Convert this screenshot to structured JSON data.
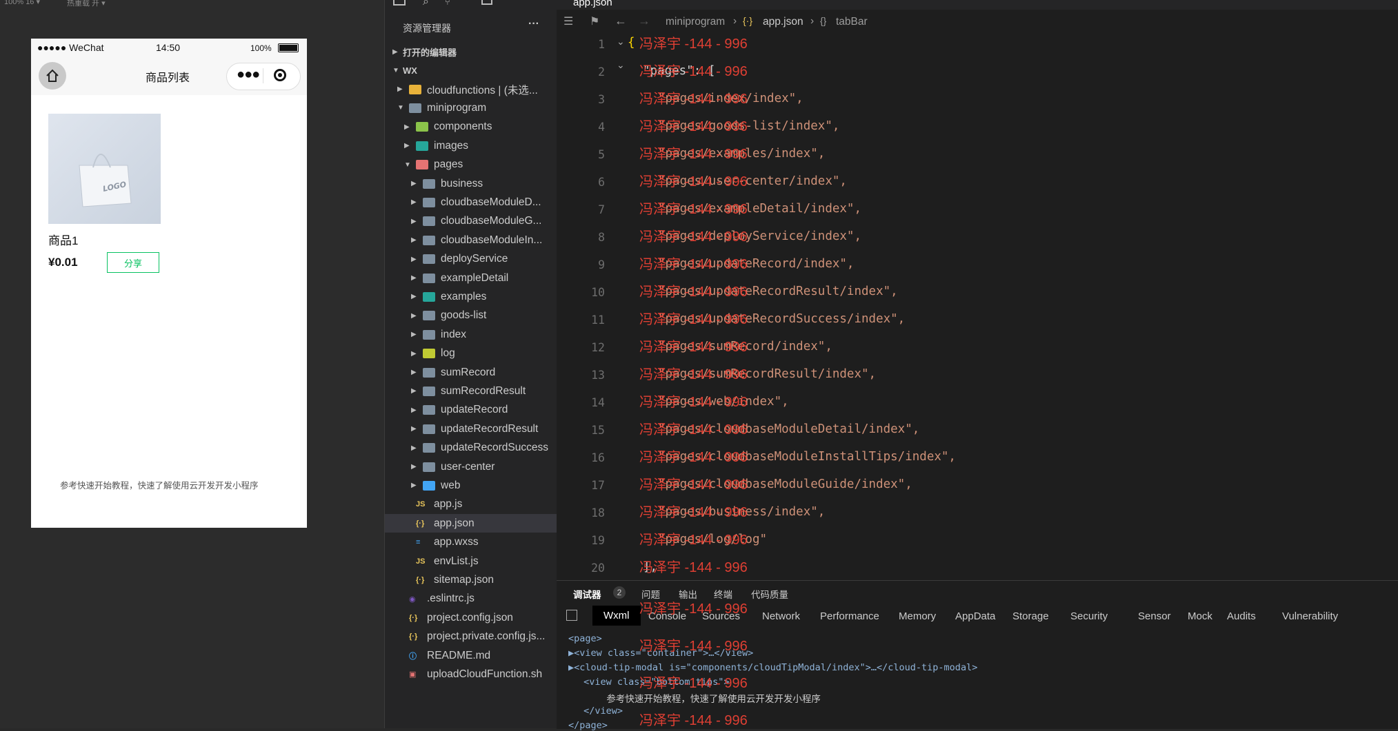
{
  "simulator": {
    "topbar_left": "100% 16 ▾",
    "topbar_mid": "热重载 开 ▾",
    "status": {
      "carrier": "●●●●● WeChat",
      "time": "14:50",
      "battery": "100%"
    },
    "nav_title": "商品列表",
    "product": {
      "name": "商品1",
      "price": "¥0.01",
      "share_label": "分享",
      "image_logo": "LOGO"
    },
    "bottom_tip": "参考快速开始教程，快速了解使用云开发开发小程序"
  },
  "explorer": {
    "title": "资源管理器",
    "more": "···",
    "section_open": "打开的编辑器",
    "section_root": "WX",
    "items": [
      {
        "label": "cloudfunctions | (未选...",
        "depth": 1,
        "chev": "▶",
        "icon": "folder-cloud"
      },
      {
        "label": "miniprogram",
        "depth": 1,
        "chev": "▼",
        "icon": "folder-open"
      },
      {
        "label": "components",
        "depth": 2,
        "chev": "▶",
        "icon": "folder-components"
      },
      {
        "label": "images",
        "depth": 2,
        "chev": "▶",
        "icon": "folder-images"
      },
      {
        "label": "pages",
        "depth": 2,
        "chev": "▼",
        "icon": "folder-pages"
      },
      {
        "label": "business",
        "depth": 3,
        "chev": "▶",
        "icon": "folder"
      },
      {
        "label": "cloudbaseModuleD...",
        "depth": 3,
        "chev": "▶",
        "icon": "folder"
      },
      {
        "label": "cloudbaseModuleG...",
        "depth": 3,
        "chev": "▶",
        "icon": "folder"
      },
      {
        "label": "cloudbaseModuleIn...",
        "depth": 3,
        "chev": "▶",
        "icon": "folder"
      },
      {
        "label": "deployService",
        "depth": 3,
        "chev": "▶",
        "icon": "folder"
      },
      {
        "label": "exampleDetail",
        "depth": 3,
        "chev": "▶",
        "icon": "folder"
      },
      {
        "label": "examples",
        "depth": 3,
        "chev": "▶",
        "icon": "folder-examples"
      },
      {
        "label": "goods-list",
        "depth": 3,
        "chev": "▶",
        "icon": "folder"
      },
      {
        "label": "index",
        "depth": 3,
        "chev": "▶",
        "icon": "folder"
      },
      {
        "label": "log",
        "depth": 3,
        "chev": "▶",
        "icon": "folder-log"
      },
      {
        "label": "sumRecord",
        "depth": 3,
        "chev": "▶",
        "icon": "folder"
      },
      {
        "label": "sumRecordResult",
        "depth": 3,
        "chev": "▶",
        "icon": "folder"
      },
      {
        "label": "updateRecord",
        "depth": 3,
        "chev": "▶",
        "icon": "folder"
      },
      {
        "label": "updateRecordResult",
        "depth": 3,
        "chev": "▶",
        "icon": "folder"
      },
      {
        "label": "updateRecordSuccess",
        "depth": 3,
        "chev": "▶",
        "icon": "folder"
      },
      {
        "label": "user-center",
        "depth": 3,
        "chev": "▶",
        "icon": "folder"
      },
      {
        "label": "web",
        "depth": 3,
        "chev": "▶",
        "icon": "folder-web"
      },
      {
        "label": "app.js",
        "depth": 2,
        "chev": "",
        "icon": "js"
      },
      {
        "label": "app.json",
        "depth": 2,
        "chev": "",
        "icon": "json",
        "selected": true
      },
      {
        "label": "app.wxss",
        "depth": 2,
        "chev": "",
        "icon": "css"
      },
      {
        "label": "envList.js",
        "depth": 2,
        "chev": "",
        "icon": "js"
      },
      {
        "label": "sitemap.json",
        "depth": 2,
        "chev": "",
        "icon": "json"
      },
      {
        "label": ".eslintrc.js",
        "depth": 1,
        "chev": "",
        "icon": "eslint"
      },
      {
        "label": "project.config.json",
        "depth": 1,
        "chev": "",
        "icon": "json"
      },
      {
        "label": "project.private.config.js...",
        "depth": 1,
        "chev": "",
        "icon": "json"
      },
      {
        "label": "README.md",
        "depth": 1,
        "chev": "",
        "icon": "info"
      },
      {
        "label": "uploadCloudFunction.sh",
        "depth": 1,
        "chev": "",
        "icon": "shell"
      }
    ]
  },
  "editor": {
    "tab": "app.json",
    "breadcrumb": [
      "miniprogram",
      "app.json",
      "tabBar"
    ],
    "lines": [
      {
        "n": "1",
        "t": "{",
        "indent": 0
      },
      {
        "n": "2",
        "t": "\"pages\": [",
        "indent": 1
      },
      {
        "n": "3",
        "t": "\"pages/index/index\",",
        "indent": 2
      },
      {
        "n": "4",
        "t": "\"pages/goods-list/index\",",
        "indent": 2
      },
      {
        "n": "5",
        "t": "\"pages/examples/index\",",
        "indent": 2
      },
      {
        "n": "6",
        "t": "\"pages/user-center/index\",",
        "indent": 2
      },
      {
        "n": "7",
        "t": "\"pages/exampleDetail/index\",",
        "indent": 2
      },
      {
        "n": "8",
        "t": "\"pages/deployService/index\",",
        "indent": 2
      },
      {
        "n": "9",
        "t": "\"pages/updateRecord/index\",",
        "indent": 2
      },
      {
        "n": "10",
        "t": "\"pages/updateRecordResult/index\",",
        "indent": 2
      },
      {
        "n": "11",
        "t": "\"pages/updateRecordSuccess/index\",",
        "indent": 2
      },
      {
        "n": "12",
        "t": "\"pages/sumRecord/index\",",
        "indent": 2
      },
      {
        "n": "13",
        "t": "\"pages/sumRecordResult/index\",",
        "indent": 2
      },
      {
        "n": "14",
        "t": "\"pages/web/index\",",
        "indent": 2
      },
      {
        "n": "15",
        "t": "\"pages/cloudbaseModuleDetail/index\",",
        "indent": 2
      },
      {
        "n": "16",
        "t": "\"pages/cloudbaseModuleInstallTips/index\",",
        "indent": 2
      },
      {
        "n": "17",
        "t": "\"pages/cloudbaseModuleGuide/index\",",
        "indent": 2
      },
      {
        "n": "18",
        "t": "\"pages/business/index\",",
        "indent": 2
      },
      {
        "n": "19",
        "t": "\"pages/log/log\"",
        "indent": 2
      },
      {
        "n": "20",
        "t": "],",
        "indent": 1
      }
    ],
    "watermark": "冯泽宇 -144 - 996"
  },
  "devtools": {
    "panel_tabs": [
      "调试器",
      "问题",
      "输出",
      "终端",
      "代码质量"
    ],
    "debugger_badge": "2",
    "tabs": [
      "Wxml",
      "Console",
      "Sources",
      "Network",
      "Performance",
      "Memory",
      "AppData",
      "Storage",
      "Security",
      "Sensor",
      "Mock",
      "Audits",
      "Vulnerability"
    ],
    "xml_lines": [
      "<page>",
      "▶<view class=\"container\">…</view>",
      "▶<cloud-tip-modal is=\"components/cloudTipModal/index\">…</cloud-tip-modal>",
      " <view class=\"bottom_tips\">",
      "   参考快速开始教程，快速了解使用云开发开发小程序",
      " </view>",
      "</page>"
    ]
  }
}
